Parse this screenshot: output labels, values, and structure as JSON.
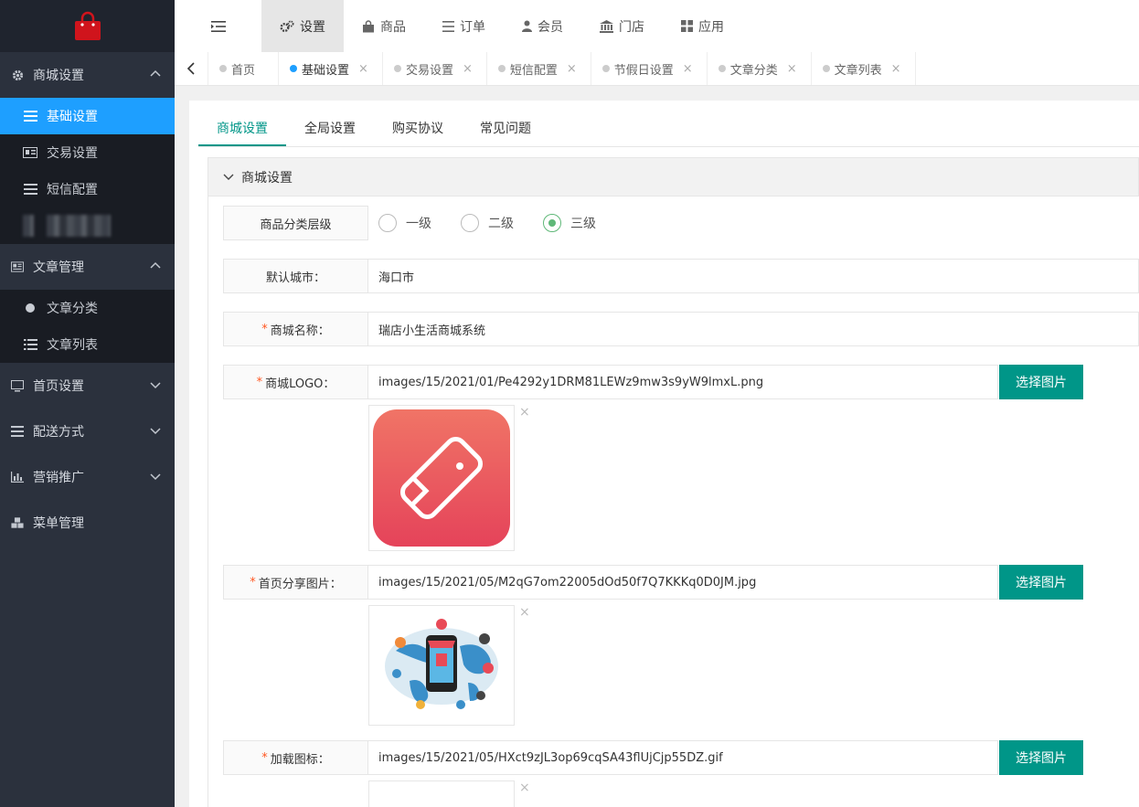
{
  "sidebar": {
    "groups": [
      {
        "label": "商城设置",
        "items": [
          {
            "label": "基础设置"
          },
          {
            "label": "交易设置"
          },
          {
            "label": "短信配置"
          }
        ]
      },
      {
        "label": "文章管理",
        "items": [
          {
            "label": "文章分类"
          },
          {
            "label": "文章列表"
          }
        ]
      },
      {
        "label": "首页设置"
      },
      {
        "label": "配送方式"
      },
      {
        "label": "营销推广"
      },
      {
        "label": "菜单管理"
      }
    ]
  },
  "topnav": {
    "tabs": [
      {
        "label": "设置",
        "icon": "gears-icon"
      },
      {
        "label": "商品",
        "icon": "bag-icon"
      },
      {
        "label": "订单",
        "icon": "list-icon"
      },
      {
        "label": "会员",
        "icon": "user-icon"
      },
      {
        "label": "门店",
        "icon": "bank-icon"
      },
      {
        "label": "应用",
        "icon": "grid-icon"
      }
    ]
  },
  "pagetabs": [
    "首页",
    "基础设置",
    "交易设置",
    "短信配置",
    "节假日设置",
    "文章分类",
    "文章列表"
  ],
  "subtabs": [
    "商城设置",
    "全局设置",
    "购买协议",
    "常见问题"
  ],
  "section": {
    "title": "商城设置"
  },
  "form": {
    "category_level": {
      "label": "商品分类层级",
      "options": [
        "一级",
        "二级",
        "三级"
      ],
      "selected": "三级"
    },
    "default_city": {
      "label": "默认城市：",
      "value": "海口市"
    },
    "shop_name": {
      "label": "商城名称：",
      "value": "瑞店小生活商城系统"
    },
    "shop_logo": {
      "label": "商城LOGO：",
      "value": "images/15/2021/01/Pe4292y1DRM81LEWz9mw3s9yW9lmxL.png",
      "button": "选择图片"
    },
    "share_image": {
      "label": "首页分享图片：",
      "value": "images/15/2021/05/M2qG7om22005dOd50f7Q7KKKq0D0JM.jpg",
      "button": "选择图片"
    },
    "loading_icon": {
      "label": "加载图标：",
      "value": "images/15/2021/05/HXct9zJL3op69cqSA43flUjCjp55DZ.gif",
      "button": "选择图片"
    },
    "remove_glyph": "×",
    "required_mark": "*"
  },
  "colors": {
    "primary": "#009688",
    "active_nav": "#1e9fff",
    "sidebar_bg": "#2b313d",
    "required": "#ff5722",
    "logo_red": "#e84a57"
  }
}
